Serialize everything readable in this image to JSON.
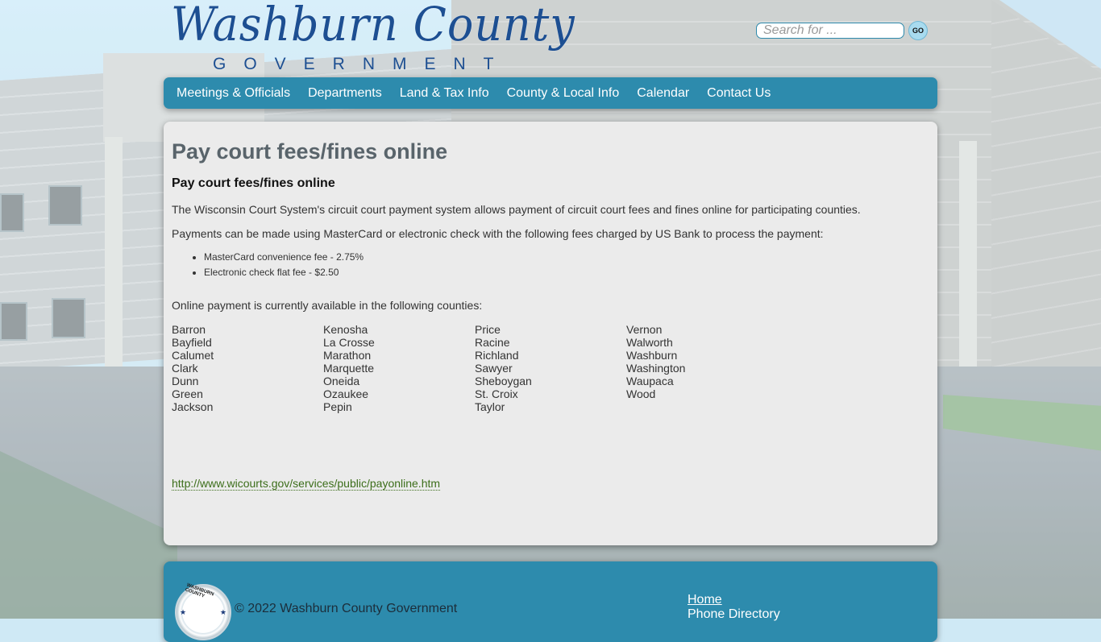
{
  "header": {
    "logo_script": "Washburn County",
    "logo_sub": "GOVERNMENT"
  },
  "search": {
    "placeholder": "Search for ...",
    "value": "",
    "go_label": "GO"
  },
  "nav": {
    "items": [
      {
        "label": "Meetings & Officials"
      },
      {
        "label": "Departments"
      },
      {
        "label": "Land & Tax Info"
      },
      {
        "label": "County & Local Info"
      },
      {
        "label": "Calendar"
      },
      {
        "label": "Contact Us"
      }
    ]
  },
  "content": {
    "title": "Pay court fees/fines online",
    "subtitle": "Pay court fees/fines online",
    "intro": "The Wisconsin Court System's circuit court payment system allows payment of circuit court fees and fines online for participating counties.",
    "payments_text": "Payments can be made using MasterCard or electronic check with the following fees charged by US Bank to process the payment:",
    "fees": [
      "MasterCard convenience fee - 2.75%",
      "Electronic check flat fee - $2.50"
    ],
    "counties_intro": "Online payment is currently available in the following counties:",
    "counties": [
      [
        "Barron",
        "Bayfield",
        "Calumet",
        "Clark",
        "Dunn",
        "Green",
        "Jackson"
      ],
      [
        "Kenosha",
        "La Crosse",
        "Marathon",
        "Marquette",
        "Oneida",
        "Ozaukee",
        "Pepin"
      ],
      [
        "Price",
        "Racine",
        "Richland",
        "Sawyer",
        "Sheboygan",
        "St. Croix",
        "Taylor"
      ],
      [
        "Vernon",
        "Walworth",
        "Washburn",
        "Washington",
        "Waupaca",
        "Wood"
      ]
    ],
    "link": "http://www.wicourts.gov/services/public/payonline.htm"
  },
  "footer": {
    "seal_text": "WASHBURN COUNTY",
    "copyright": "© 2022 Washburn County Government",
    "links": [
      {
        "label": "Home"
      },
      {
        "label": "Phone Directory"
      }
    ]
  },
  "colors": {
    "nav_bg": "#2d8bad",
    "title": "#59646b",
    "link": "#3c6e1a",
    "logo": "#1d4f92"
  }
}
